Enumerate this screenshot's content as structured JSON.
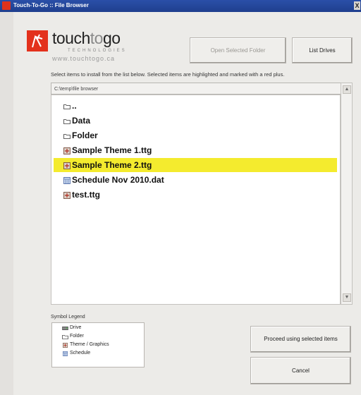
{
  "window": {
    "title": "Touch-To-Go :: File Browser",
    "close_label": "X"
  },
  "logo": {
    "brand_touch": "touch",
    "brand_to": "to",
    "brand_go": "go",
    "subline": "TECHNOLOGIES",
    "url": "www.touchtogo.ca"
  },
  "toolbar": {
    "open_folder_label": "Open Selected Folder",
    "list_drives_label": "List Drives"
  },
  "instructions": "Select items to install from the list below.  Selected items are highlighted and marked with a red plus.",
  "path": "C:\\temp\\file browser",
  "files": [
    {
      "label": "..",
      "icon": "folder-icon",
      "selected": false
    },
    {
      "label": "Data",
      "icon": "folder-icon",
      "selected": false
    },
    {
      "label": "Folder",
      "icon": "folder-icon",
      "selected": false
    },
    {
      "label": "Sample Theme 1.ttg",
      "icon": "theme-icon",
      "selected": false
    },
    {
      "label": "Sample Theme 2.ttg",
      "icon": "theme-icon",
      "selected": true
    },
    {
      "label": "Schedule Nov 2010.dat",
      "icon": "schedule-icon",
      "selected": false
    },
    {
      "label": "test.ttg",
      "icon": "theme-icon",
      "selected": false
    }
  ],
  "legend": {
    "title": "Symbol Legend",
    "items": [
      {
        "label": "Drive",
        "icon": "drive-icon"
      },
      {
        "label": "Folder",
        "icon": "folder-icon"
      },
      {
        "label": "Theme / Graphics",
        "icon": "theme-icon"
      },
      {
        "label": "Schedule",
        "icon": "schedule-icon"
      }
    ]
  },
  "actions": {
    "proceed_label": "Proceed using selected items",
    "cancel_label": "Cancel"
  },
  "colors": {
    "selection_highlight": "#f4eb2e",
    "brand_red": "#e3311c",
    "titlebar_blue": "#2a4fa8"
  }
}
